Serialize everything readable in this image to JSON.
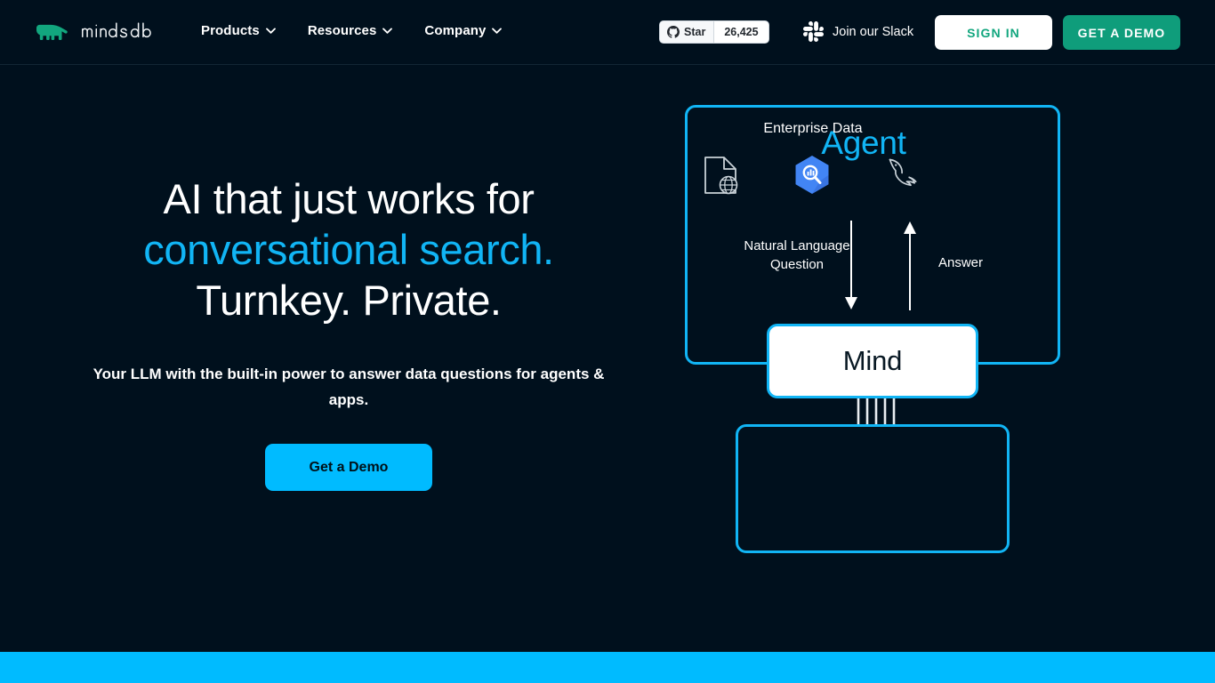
{
  "brand": {
    "name": "mindsdb",
    "logo_icon": "mindsdb-elephant-logo",
    "logo_color": "#12a67e"
  },
  "header": {
    "nav": [
      {
        "label": "Products",
        "icon": "chevron-down-icon"
      },
      {
        "label": "Resources",
        "icon": "chevron-down-icon"
      },
      {
        "label": "Company",
        "icon": "chevron-down-icon"
      }
    ],
    "github": {
      "icon": "github-icon",
      "label": "Star",
      "count": "26,425"
    },
    "slack": {
      "icon": "slack-icon",
      "label": "Join our Slack"
    },
    "sign_in_label": "SIGN IN",
    "get_demo_label": "GET A DEMO"
  },
  "hero": {
    "title_line1": "AI that just works for",
    "title_line2_accent": "conversational search.",
    "title_line3": "Turnkey. Private.",
    "subtitle": "Your LLM with the built-in power to answer data questions for agents & apps.",
    "cta_label": "Get a Demo"
  },
  "diagram": {
    "agent_label": "Agent",
    "question_label": "Natural Language Question",
    "answer_label": "Answer",
    "mind_label": "Mind",
    "data_label": "Enterprise Data",
    "data_sources": [
      {
        "icon": "web-document-icon",
        "name": "Web page data source"
      },
      {
        "icon": "bigquery-icon",
        "name": "Google BigQuery"
      },
      {
        "icon": "mysql-dolphin-icon",
        "name": "MySQL"
      }
    ],
    "arrow_down_icon": "arrow-down-icon",
    "arrow_up_icon": "arrow-up-icon",
    "connector_icon": "pin-connector-icon"
  },
  "colors": {
    "background": "#00101d",
    "accent_cyan": "#11b5f5",
    "accent_bright_cyan": "#00bbff",
    "accent_green": "#0f9d7b",
    "logo_green": "#12a67e"
  }
}
